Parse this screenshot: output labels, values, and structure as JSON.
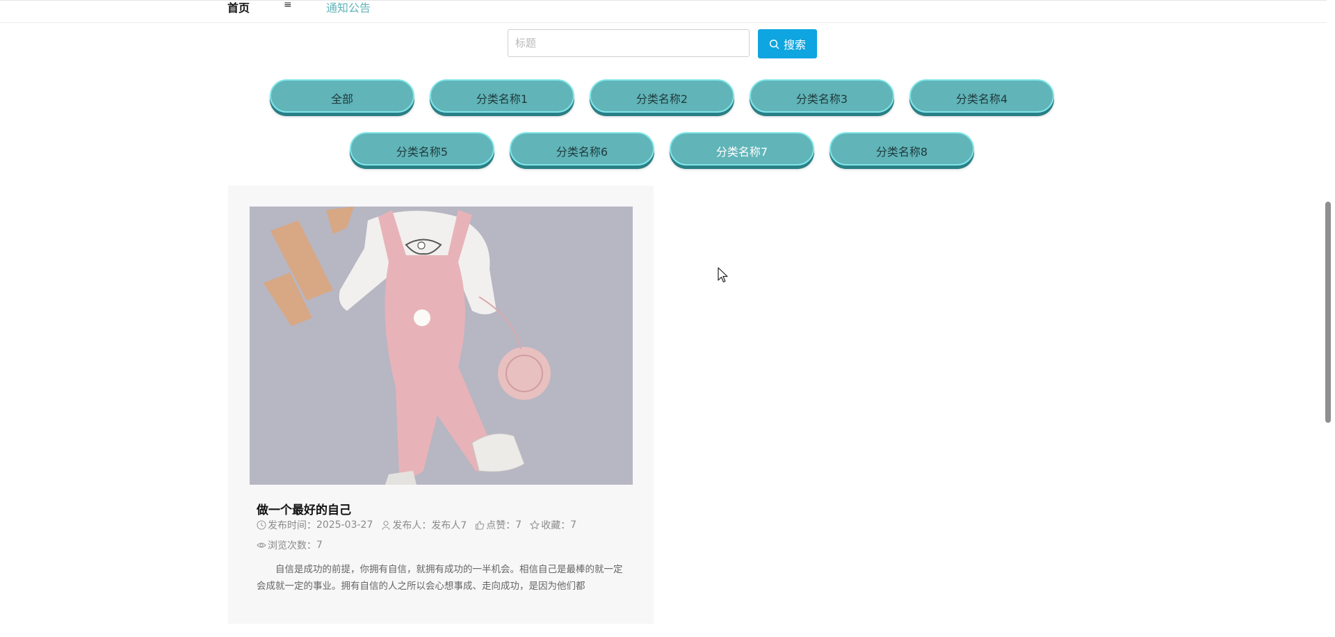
{
  "nav": {
    "home_label": "首页",
    "menu_glyph": "≡",
    "notice_label": "通知公告",
    "accent_color": "#61b4b8"
  },
  "search": {
    "placeholder": "标题",
    "value": "",
    "button_label": "搜索",
    "button_icon": "search-icon",
    "button_color": "#0ea5e0"
  },
  "categories": [
    {
      "label": "全部"
    },
    {
      "label": "分类名称1"
    },
    {
      "label": "分类名称2"
    },
    {
      "label": "分类名称3"
    },
    {
      "label": "分类名称4"
    },
    {
      "label": "分类名称5"
    },
    {
      "label": "分类名称6"
    },
    {
      "label": "分类名称7"
    },
    {
      "label": "分类名称8"
    }
  ],
  "article": {
    "image_icon": "photo",
    "title": "做一个最好的自己",
    "publish_time_label": "发布时间：",
    "publish_time": "2025-03-27",
    "publisher_label": "发布人：",
    "publisher": "发布人7",
    "likes_label": "点赞：",
    "likes": "7",
    "favorites_label": "收藏：",
    "favorites": "7",
    "views_label": "浏览次数：",
    "views": "7",
    "description": "自信是成功的前提，你拥有自信，就拥有成功的一半机会。相信自己是最棒的就一定会成就一定的事业。拥有自信的人之所以会心想事成、走向成功，是因为他们都"
  }
}
